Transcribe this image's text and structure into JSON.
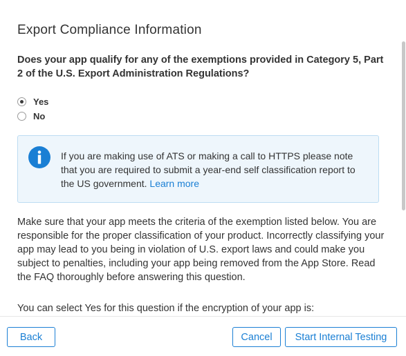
{
  "dialog": {
    "title": "Export Compliance Information",
    "question": "Does your app qualify for any of the exemptions provided in Category 5, Part 2 of the U.S. Export Administration Regulations?",
    "options": [
      {
        "label": "Yes",
        "selected": true
      },
      {
        "label": "No",
        "selected": false
      }
    ],
    "info": {
      "icon": "info-icon",
      "text": "If you are making use of ATS or making a call to HTTPS please note that you are required to submit a year-end self classification report to the US government.",
      "link": "Learn more",
      "accent_color": "#1a7fd4"
    },
    "body": "Make sure that your app meets the criteria of the exemption listed below. You are responsible for the proper classification of your product. Incorrectly classifying your app may lead to you being in violation of U.S. export laws and could make you subject to penalties, including your app being removed from the App Store. Read the FAQ thoroughly before answering this question.",
    "select_text": "You can select Yes for this question if the encryption of your app is:"
  },
  "footer": {
    "back_label": "Back",
    "cancel_label": "Cancel",
    "start_label": "Start Internal Testing"
  }
}
